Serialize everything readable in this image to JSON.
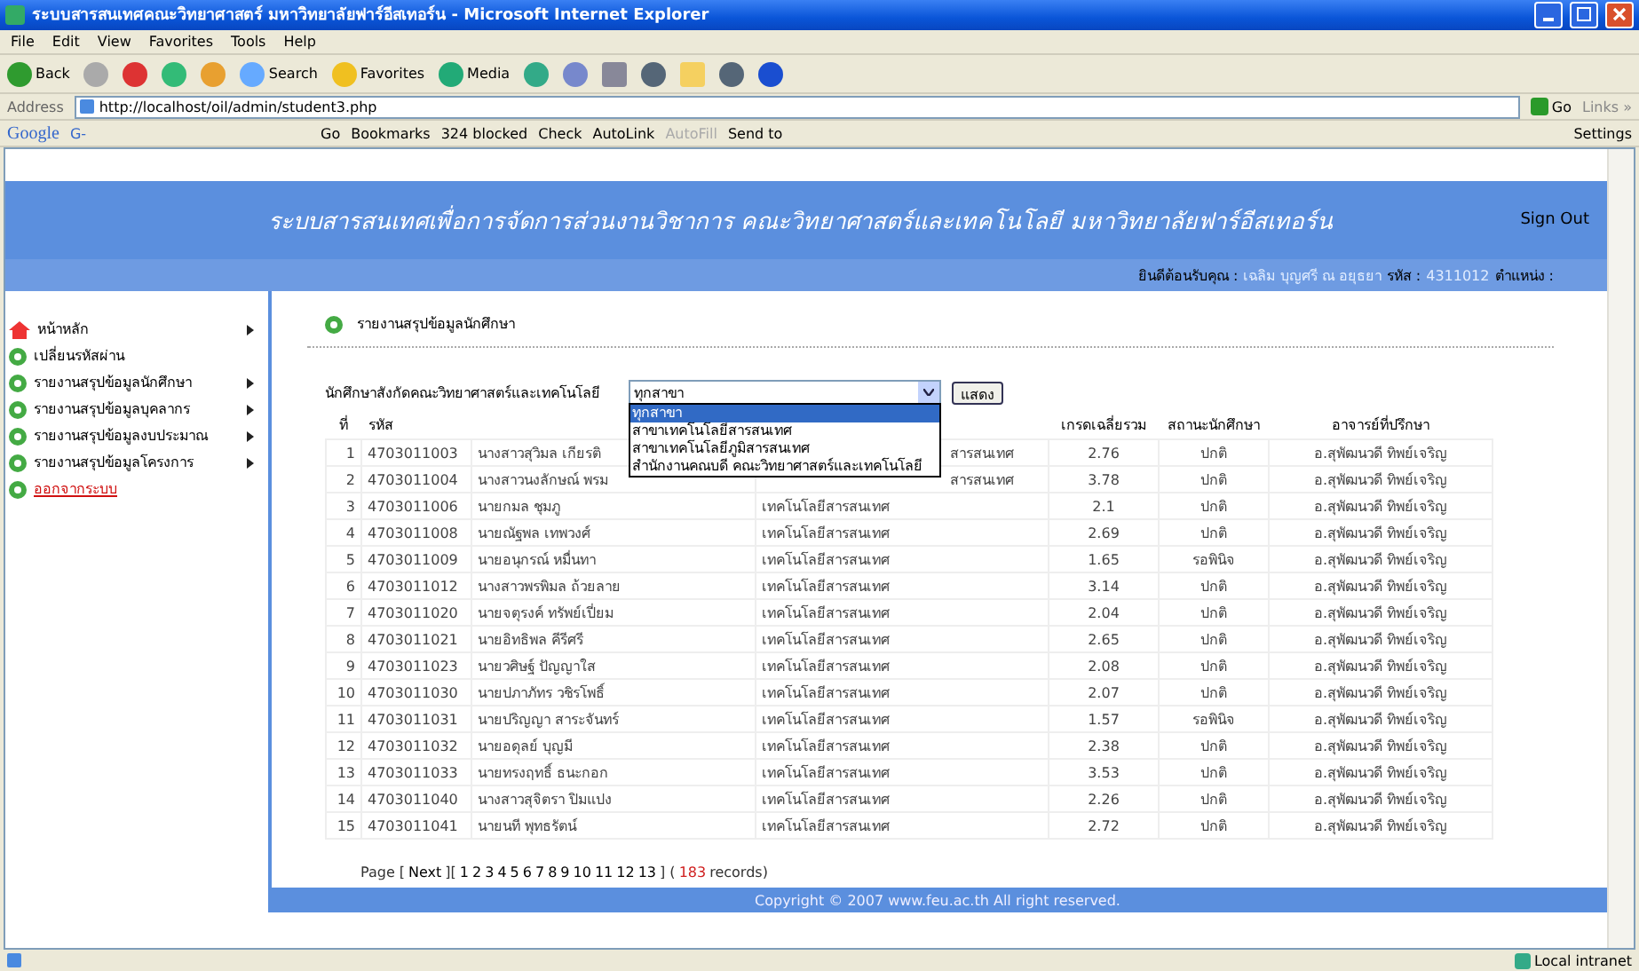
{
  "window": {
    "title": "ระบบสารสนเทศคณะวิทยาศาสตร์ มหาวิทยาลัยฟาร์อีสเทอร์น - Microsoft Internet Explorer"
  },
  "menu": [
    "File",
    "Edit",
    "View",
    "Favorites",
    "Tools",
    "Help"
  ],
  "toolbar": [
    {
      "kind": "back",
      "label": "Back"
    },
    {
      "kind": "forward"
    },
    {
      "kind": "stop"
    },
    {
      "kind": "refresh"
    },
    {
      "kind": "home"
    },
    {
      "kind": "search",
      "label": "Search"
    },
    {
      "kind": "favorites",
      "label": "Favorites"
    },
    {
      "kind": "media",
      "label": "Media"
    },
    {
      "kind": "history"
    },
    {
      "kind": "mail"
    },
    {
      "kind": "print"
    },
    {
      "kind": "edit"
    },
    {
      "kind": "folder"
    },
    {
      "kind": "calendar"
    },
    {
      "kind": "bluetooth"
    }
  ],
  "address": {
    "label": "Address",
    "url": "http://localhost/oil/admin/student3.php",
    "go": "Go",
    "links": "Links »"
  },
  "google_bar": {
    "logo": "Google",
    "g": "G-",
    "items": [
      "Go",
      "Bookmarks",
      "324 blocked",
      "Check",
      "AutoLink",
      "AutoFill",
      "Send to"
    ],
    "settings": "Settings"
  },
  "site": {
    "title": "ระบบสารสนเทศเพื่อการจัดการส่วนงานวิชาการ คณะวิทยาศาสตร์และเทคโนโลยี มหาวิทยาลัยฟาร์อีสเทอร์น",
    "sign_out": "Sign Out",
    "welcome": "ยินดีต้อนรับคุณ :",
    "user": "เฉลิม บุญศรี ณ อยุธยา",
    "id_label": "รหัส :",
    "id": "4311012",
    "position_label": "ตำแหน่ง :"
  },
  "sidebar": [
    {
      "kind": "home",
      "label": "หน้าหลัก",
      "submenu": true
    },
    {
      "kind": "item",
      "label": "เปลี่ยนรหัสผ่าน",
      "submenu": false
    },
    {
      "kind": "item",
      "label": "รายงานสรุปข้อมูลนักศึกษา",
      "submenu": true
    },
    {
      "kind": "item",
      "label": "รายงานสรุปข้อมูลบุคลากร",
      "submenu": true
    },
    {
      "kind": "item",
      "label": "รายงานสรุปข้อมูลงบประมาณ",
      "submenu": true
    },
    {
      "kind": "item",
      "label": "รายงานสรุปข้อมูลโครงการ",
      "submenu": true
    },
    {
      "kind": "logout",
      "label": "ออกจากระบบ",
      "submenu": false
    }
  ],
  "panel": {
    "title": "รายงานสรุปข้อมูลนักศึกษา",
    "filter_label": "นักศึกษาสังกัดคณะวิทยาศาสตร์และเทคโนโลยี",
    "select": {
      "value": "ทุกสาขา",
      "open": true,
      "options": [
        {
          "label": "ทุกสาขา",
          "selected": true
        },
        {
          "label": "สาขาเทคโนโลยีสารสนเทศ",
          "selected": false
        },
        {
          "label": "สาขาเทคโนโลยีภูมิสารสนเทศ",
          "selected": false
        },
        {
          "label": "สำนักงานคณบดี คณะวิทยาศาสตร์และเทคโนโลยี",
          "selected": false
        }
      ]
    },
    "button": "แสดง"
  },
  "table": {
    "columns": [
      "ที่",
      "รหัส",
      "",
      "",
      "เกรดเฉลี่ยรวม",
      "สถานะนักศึกษา",
      "อาจารย์ที่ปรึกษา"
    ],
    "rows": [
      [
        "1",
        "4703011003",
        "นางสาวสุวิมล เกียรติ",
        "สารสนเทศ",
        "2.76",
        "ปกติ",
        "อ.สุพัฒนวดี ทิพย์เจริญ"
      ],
      [
        "2",
        "4703011004",
        "นางสาวนงลักษณ์ พรม",
        "สารสนเทศ",
        "3.78",
        "ปกติ",
        "อ.สุพัฒนวดี ทิพย์เจริญ"
      ],
      [
        "3",
        "4703011006",
        "นายกมล ชุมภู",
        "เทคโนโลยีสารสนเทศ",
        "2.1",
        "ปกติ",
        "อ.สุพัฒนวดี ทิพย์เจริญ"
      ],
      [
        "4",
        "4703011008",
        "นายณัฐพล เทพวงศ์",
        "เทคโนโลยีสารสนเทศ",
        "2.69",
        "ปกติ",
        "อ.สุพัฒนวดี ทิพย์เจริญ"
      ],
      [
        "5",
        "4703011009",
        "นายอนุกรณ์ หมื่นทา",
        "เทคโนโลยีสารสนเทศ",
        "1.65",
        "รอพินิจ",
        "อ.สุพัฒนวดี ทิพย์เจริญ"
      ],
      [
        "6",
        "4703011012",
        "นางสาวพรพิมล ถ้วยลาย",
        "เทคโนโลยีสารสนเทศ",
        "3.14",
        "ปกติ",
        "อ.สุพัฒนวดี ทิพย์เจริญ"
      ],
      [
        "7",
        "4703011020",
        "นายจตุรงค์ ทรัพย์เปี่ยม",
        "เทคโนโลยีสารสนเทศ",
        "2.04",
        "ปกติ",
        "อ.สุพัฒนวดี ทิพย์เจริญ"
      ],
      [
        "8",
        "4703011021",
        "นายอิทธิพล คีรีศรี",
        "เทคโนโลยีสารสนเทศ",
        "2.65",
        "ปกติ",
        "อ.สุพัฒนวดี ทิพย์เจริญ"
      ],
      [
        "9",
        "4703011023",
        "นายวศิษฐ์ ปัญญาใส",
        "เทคโนโลยีสารสนเทศ",
        "2.08",
        "ปกติ",
        "อ.สุพัฒนวดี ทิพย์เจริญ"
      ],
      [
        "10",
        "4703011030",
        "นายปภาภัทร วชิรโพธิ์",
        "เทคโนโลยีสารสนเทศ",
        "2.07",
        "ปกติ",
        "อ.สุพัฒนวดี ทิพย์เจริญ"
      ],
      [
        "11",
        "4703011031",
        "นายปริญญา สาระจันทร์",
        "เทคโนโลยีสารสนเทศ",
        "1.57",
        "รอพินิจ",
        "อ.สุพัฒนวดี ทิพย์เจริญ"
      ],
      [
        "12",
        "4703011032",
        "นายอดุลย์ บุญมี",
        "เทคโนโลยีสารสนเทศ",
        "2.38",
        "ปกติ",
        "อ.สุพัฒนวดี ทิพย์เจริญ"
      ],
      [
        "13",
        "4703011033",
        "นายทรงฤทธิ์ ธนะกอก",
        "เทคโนโลยีสารสนเทศ",
        "3.53",
        "ปกติ",
        "อ.สุพัฒนวดี ทิพย์เจริญ"
      ],
      [
        "14",
        "4703011040",
        "นางสาวสุจิตรา ปิมแปง",
        "เทคโนโลยีสารสนเทศ",
        "2.26",
        "ปกติ",
        "อ.สุพัฒนวดี ทิพย์เจริญ"
      ],
      [
        "15",
        "4703011041",
        "นายนที พุทธรัตน์",
        "เทคโนโลยีสารสนเทศ",
        "2.72",
        "ปกติ",
        "อ.สุพัฒนวดี ทิพย์เจริญ"
      ]
    ]
  },
  "pager": {
    "prefix": "Page [",
    "next": "Next",
    "mid": "][",
    "pages": [
      "1",
      "2",
      "3",
      "4",
      "5",
      "6",
      "7",
      "8",
      "9",
      "10",
      "11",
      "12",
      "13"
    ],
    "close": "] (",
    "count": "183",
    "suffix": "records)"
  },
  "footer": "Copyright © 2007 www.feu.ac.th All right reserved.",
  "status_bar": {
    "zone": "Local intranet"
  }
}
